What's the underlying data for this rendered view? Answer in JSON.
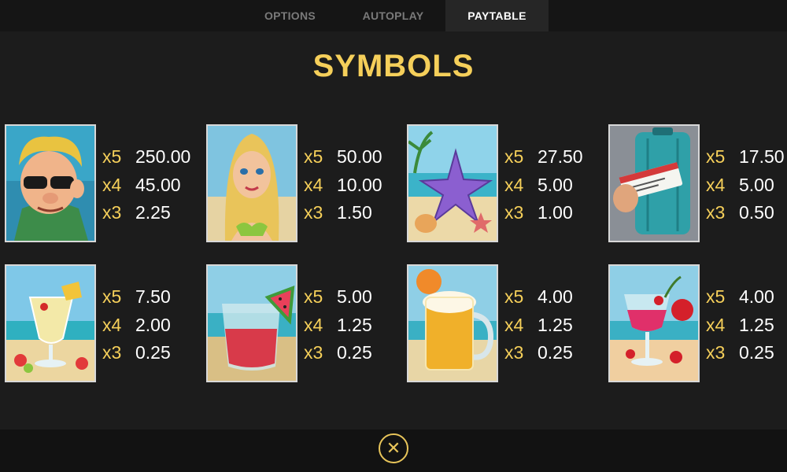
{
  "tabs": [
    {
      "label": "OPTIONS",
      "active": false
    },
    {
      "label": "AUTOPLAY",
      "active": false
    },
    {
      "label": "PAYTABLE",
      "active": true
    }
  ],
  "title": "SYMBOLS",
  "symbols": [
    {
      "icon": "man-with-sunglasses-icon",
      "payouts": [
        {
          "mult": "x5",
          "value": "250.00"
        },
        {
          "mult": "x4",
          "value": "45.00"
        },
        {
          "mult": "x3",
          "value": "2.25"
        }
      ]
    },
    {
      "icon": "blonde-woman-icon",
      "payouts": [
        {
          "mult": "x5",
          "value": "50.00"
        },
        {
          "mult": "x4",
          "value": "10.00"
        },
        {
          "mult": "x3",
          "value": "1.50"
        }
      ]
    },
    {
      "icon": "starfish-icon",
      "payouts": [
        {
          "mult": "x5",
          "value": "27.50"
        },
        {
          "mult": "x4",
          "value": "5.00"
        },
        {
          "mult": "x3",
          "value": "1.00"
        }
      ]
    },
    {
      "icon": "suitcase-ticket-icon",
      "payouts": [
        {
          "mult": "x5",
          "value": "17.50"
        },
        {
          "mult": "x4",
          "value": "5.00"
        },
        {
          "mult": "x3",
          "value": "0.50"
        }
      ]
    },
    {
      "icon": "pina-colada-icon",
      "payouts": [
        {
          "mult": "x5",
          "value": "7.50"
        },
        {
          "mult": "x4",
          "value": "2.00"
        },
        {
          "mult": "x3",
          "value": "0.25"
        }
      ]
    },
    {
      "icon": "watermelon-juice-icon",
      "payouts": [
        {
          "mult": "x5",
          "value": "5.00"
        },
        {
          "mult": "x4",
          "value": "1.25"
        },
        {
          "mult": "x3",
          "value": "0.25"
        }
      ]
    },
    {
      "icon": "beer-mug-icon",
      "payouts": [
        {
          "mult": "x5",
          "value": "4.00"
        },
        {
          "mult": "x4",
          "value": "1.25"
        },
        {
          "mult": "x3",
          "value": "0.25"
        }
      ]
    },
    {
      "icon": "cherry-cocktail-icon",
      "payouts": [
        {
          "mult": "x5",
          "value": "4.00"
        },
        {
          "mult": "x4",
          "value": "1.25"
        },
        {
          "mult": "x3",
          "value": "0.25"
        }
      ]
    }
  ],
  "close_icon": "close-icon",
  "colors": {
    "accent": "#f5cf5a",
    "background": "#1c1c1c",
    "tab_active": "#262626"
  }
}
